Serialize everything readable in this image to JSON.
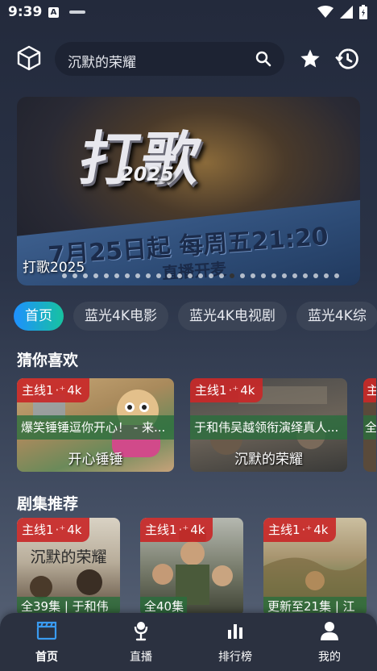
{
  "status": {
    "time": "9:39",
    "a_badge": "A"
  },
  "search": {
    "query": "沉默的荣耀"
  },
  "banner": {
    "logo": "打歌",
    "year": "2025",
    "tagline": "7月25日起 每周五21:20",
    "tagline2": "直播开麦",
    "title": "打歌2025",
    "dots": 27,
    "active_dot": 16
  },
  "tabs": [
    {
      "label": "首页",
      "active": true
    },
    {
      "label": "蓝光4K电影",
      "active": false
    },
    {
      "label": "蓝光4K电视剧",
      "active": false
    },
    {
      "label": "蓝光4K综",
      "active": false
    }
  ],
  "guess": {
    "title": "猜你喜欢",
    "cards": [
      {
        "badge_a": "主线1",
        "badge_b": "4k",
        "desc": "爆笑锤锤逗你开心！ - 来...",
        "name": "开心锤锤"
      },
      {
        "badge_a": "主线1",
        "badge_b": "4k",
        "desc": "于和伟吴越领衔演绎真人...",
        "name": "沉默的荣耀"
      },
      {
        "badge_a": "主",
        "badge_b": "",
        "desc": "全",
        "name": ""
      }
    ]
  },
  "series": {
    "title": "剧集推荐",
    "cards": [
      {
        "badge_a": "主线1",
        "badge_b": "4k",
        "poster_text": "沉默的荣耀",
        "desc": "全39集 | 于和伟"
      },
      {
        "badge_a": "主线1",
        "badge_b": "4k",
        "poster_text": "",
        "desc": "全40集"
      },
      {
        "badge_a": "主线1",
        "badge_b": "4k",
        "poster_text": "",
        "desc": "更新至21集 | 江"
      }
    ]
  },
  "nav": [
    {
      "label": "首页",
      "icon": "clapperboard-icon",
      "active": true
    },
    {
      "label": "直播",
      "icon": "microphone-icon",
      "active": false
    },
    {
      "label": "排行榜",
      "icon": "bar-chart-icon",
      "active": false
    },
    {
      "label": "我的",
      "icon": "person-icon",
      "active": false
    }
  ],
  "colors": {
    "accent_blue": "#3a9bf0",
    "tab_gradient_start": "#1e90ff",
    "tab_gradient_end": "#17c3a0",
    "badge_red": "#c82828",
    "desc_green": "#286e3c"
  }
}
